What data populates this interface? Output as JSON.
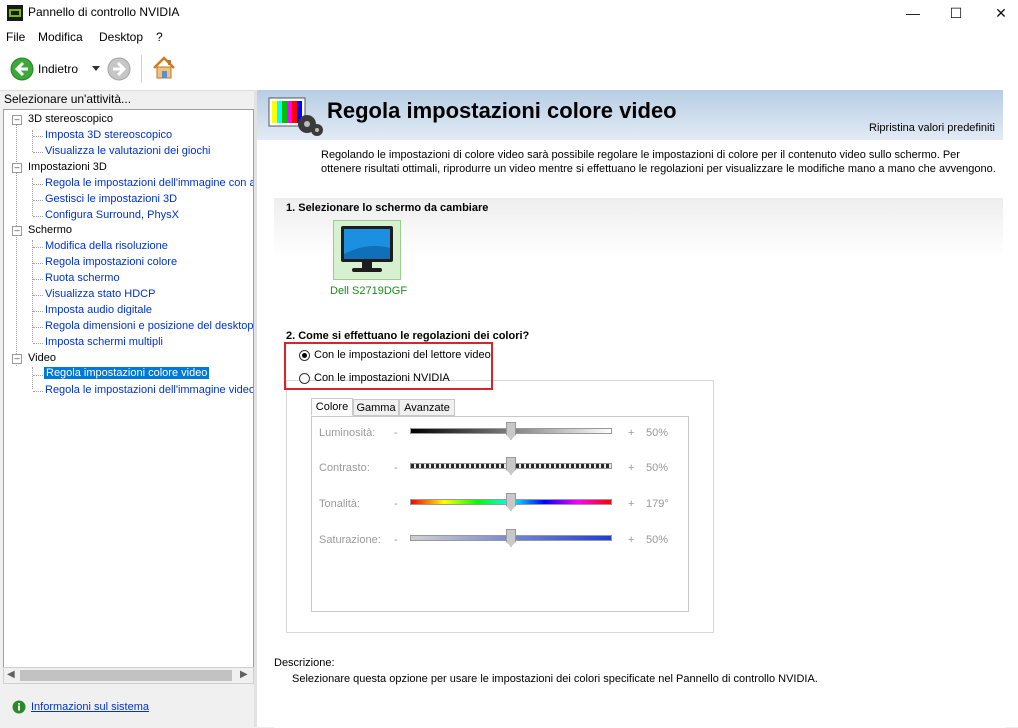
{
  "window": {
    "title": "Pannello di controllo NVIDIA"
  },
  "menu": [
    "File",
    "Modifica",
    "Desktop",
    "?"
  ],
  "toolbar": {
    "back_label": "Indietro"
  },
  "left_panel": {
    "header": "Selezionare un'attività...",
    "tree": [
      {
        "label": "3D stereoscopico",
        "children": [
          "Imposta 3D stereoscopico",
          "Visualizza le valutazioni dei giochi"
        ]
      },
      {
        "label": "Impostazioni 3D",
        "children": [
          "Regola le impostazioni dell'immagine con an",
          "Gestisci le impostazioni 3D",
          "Configura Surround, PhysX"
        ]
      },
      {
        "label": "Schermo",
        "children": [
          "Modifica della risoluzione",
          "Regola impostazioni colore",
          "Ruota schermo",
          "Visualizza stato HDCP",
          "Imposta audio digitale",
          "Regola dimensioni e posizione del desktop",
          "Imposta schermi multipli"
        ]
      },
      {
        "label": "Video",
        "children": [
          "Regola impostazioni colore video",
          "Regola le impostazioni dell'immagine video"
        ]
      }
    ],
    "selected": "Regola impostazioni colore video",
    "system_info": "Informazioni sul sistema"
  },
  "main": {
    "title": "Regola impostazioni colore video",
    "restore_defaults": "Ripristina valori predefiniti",
    "intro": "Regolando le impostazioni di colore video sarà possibile regolare le impostazioni di colore per il contenuto video sullo schermo. Per ottenere risultati ottimali, riprodurre un video mentre si effettuano le regolazioni per visualizzare le modifiche mano a mano che avvengono.",
    "section1_title": "1. Selezionare lo schermo da cambiare",
    "display_name": "Dell S2719DGF",
    "section2_title": "2. Come si effettuano le regolazioni dei colori?",
    "options": [
      {
        "label": "Con le impostazioni del lettore video",
        "selected": true
      },
      {
        "label": "Con le impostazioni NVIDIA",
        "selected": false
      }
    ],
    "tabs": [
      "Colore",
      "Gamma",
      "Avanzate"
    ],
    "active_tab": "Colore",
    "sliders": [
      {
        "label": "Luminosità:",
        "minus": "-",
        "plus": "+",
        "value": "50%",
        "level": 0.5
      },
      {
        "label": "Contrasto:",
        "minus": "-",
        "plus": "+",
        "value": "50%",
        "level": 0.5
      },
      {
        "label": "Tonalità:",
        "minus": "-",
        "plus": "+",
        "value": "179°",
        "level": 0.5
      },
      {
        "label": "Saturazione:",
        "minus": "-",
        "plus": "+",
        "value": "50%",
        "level": 0.5
      }
    ],
    "description_title": "Descrizione:",
    "description_text": "Selezionare questa opzione per usare le impostazioni dei colori specificate nel Pannello di controllo NVIDIA."
  },
  "colors": {
    "highlight": "#0078d7",
    "link": "#0033cc",
    "callout": "#d9252a",
    "nvidia_green": "#76b900"
  }
}
